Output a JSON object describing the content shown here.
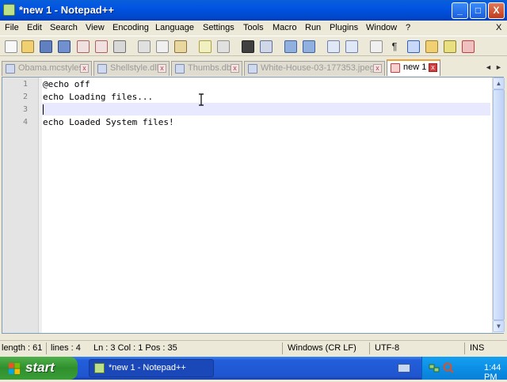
{
  "window": {
    "title": "*new 1 - Notepad++",
    "caption_buttons": {
      "minimize": "_",
      "maximize": "□",
      "close": "X"
    }
  },
  "menu": {
    "items": [
      "File",
      "Edit",
      "Search",
      "View",
      "Encoding",
      "Language",
      "Settings",
      "Tools",
      "Macro",
      "Run",
      "Plugins",
      "Window",
      "?"
    ],
    "close_label": "X"
  },
  "toolbar": {
    "icons": [
      "new-file-icon",
      "open-file-icon",
      "save-icon",
      "save-all-icon",
      "close-icon",
      "close-all-icon",
      "print-icon",
      "cut-icon",
      "copy-icon",
      "paste-icon",
      "undo-icon",
      "redo-icon",
      "find-icon",
      "replace-icon",
      "zoom-in-icon",
      "zoom-out-icon",
      "sync-vertical-icon",
      "sync-horizontal-icon",
      "word-wrap-icon",
      "show-all-chars-icon",
      "indent-guide-icon",
      "folder-as-workspace-icon",
      "macro-record-icon",
      "macro-stop-icon"
    ]
  },
  "tabs": [
    {
      "label": "Obama.mcstyles",
      "active": false
    },
    {
      "label": "Shellstyle.dll",
      "active": false
    },
    {
      "label": "Thumbs.db",
      "active": false
    },
    {
      "label": "White-House-03-177353.jpeg",
      "active": false
    },
    {
      "label": "new 1",
      "active": true
    }
  ],
  "tab_scroll": {
    "left": "◄",
    "right": "►"
  },
  "editor": {
    "line_numbers": [
      "1",
      "2",
      "3",
      "4"
    ],
    "lines": [
      "@echo off",
      "echo Loading files...",
      "",
      "echo Loaded System files!"
    ],
    "current_line": 3
  },
  "scrollbar": {
    "up": "▲",
    "down": "▼"
  },
  "statusbar": {
    "length": "length : 61",
    "lines": "lines : 4",
    "position": "Ln : 3    Col : 1    Pos : 35",
    "eol": "Windows (CR LF)",
    "encoding": "UTF-8",
    "mode": "INS"
  },
  "taskbar": {
    "start_label": "start",
    "task_label": "*new 1 - Notepad++",
    "clock": "1:44 PM"
  },
  "colors": {
    "titlebar": "#0054e3",
    "active_tab_accent": "#f0a030",
    "current_line_highlight": "#e8e8ff",
    "start_button": "#3a9d37",
    "tray": "#0c8fe6"
  }
}
